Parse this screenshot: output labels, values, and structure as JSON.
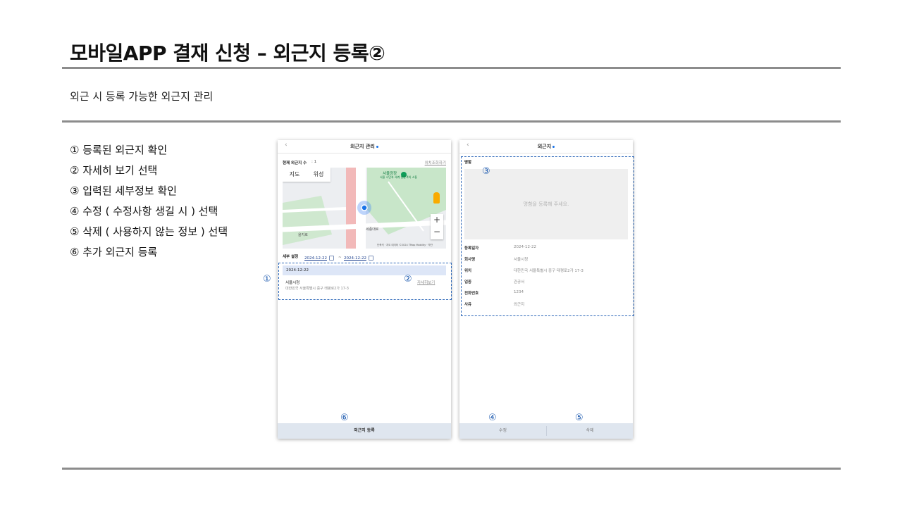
{
  "slide": {
    "title": "모바일APP 결재 신청 – 외근지 등록②",
    "subtitle": "외근 시 등록 가능한 외근지 관리",
    "steps": [
      "① 등록된 외근지 확인",
      "② 자세히 보기 선택",
      "③ 입력된 세부정보 확인",
      "④ 수정 ( 수정사항 생길 시 ) 선택",
      "⑤ 삭제 ( 사용하지 않는 정보 ) 선택",
      "⑥ 추가 외근지 등록"
    ]
  },
  "screen1": {
    "back_icon": "‹",
    "title": "외근지 관리",
    "count_label": "현재 외근지 수",
    "count_value": ": 1",
    "history_link": "위치조회하기",
    "map": {
      "tab_map": "지도",
      "tab_satellite": "위성",
      "zoom_in": "+",
      "zoom_out": "−",
      "poi_label": "서울광장",
      "poi_sub": "서울 시민과 세계 방문객의 소통",
      "street_label": "세종대로",
      "street_label2": "을지로",
      "attribution": "단축키 · 지도 데이터 ©2024 TMap Mobility · 약관"
    },
    "filter_label": "세부 설정",
    "date_from": "2024-12-22",
    "date_to": "2024-12-22",
    "item": {
      "date": "2024-12-22",
      "name": "서울시청",
      "address": "대한민국 서울특별시 중구 태평로2가 17-3",
      "detail_link": "자세히보기"
    },
    "register_button": "외근지 등록"
  },
  "screen2": {
    "back_icon": "‹",
    "title": "외근지",
    "card_label": "명함",
    "card_placeholder": "명함을 등록해 주세요.",
    "details": [
      {
        "key": "등록일자",
        "value": "2024-12-22"
      },
      {
        "key": "회사명",
        "value": "서울시청"
      },
      {
        "key": "위치",
        "value": "대한민국 서울특별시 중구 태평로2가 17-3"
      },
      {
        "key": "업종",
        "value": "관공서"
      },
      {
        "key": "전화번호",
        "value": "1234"
      },
      {
        "key": "사유",
        "value": "외근지"
      }
    ],
    "edit_button": "수정",
    "delete_button": "삭제"
  },
  "markers": {
    "m1": "①",
    "m2": "②",
    "m3": "③",
    "m4": "④",
    "m5": "⑤",
    "m6": "⑥"
  },
  "colors": {
    "annotation": "#2b66b8",
    "divider": "#8c8c8c",
    "selected_row": "#dde6f7",
    "bottom_bar": "#dfe6ef"
  }
}
